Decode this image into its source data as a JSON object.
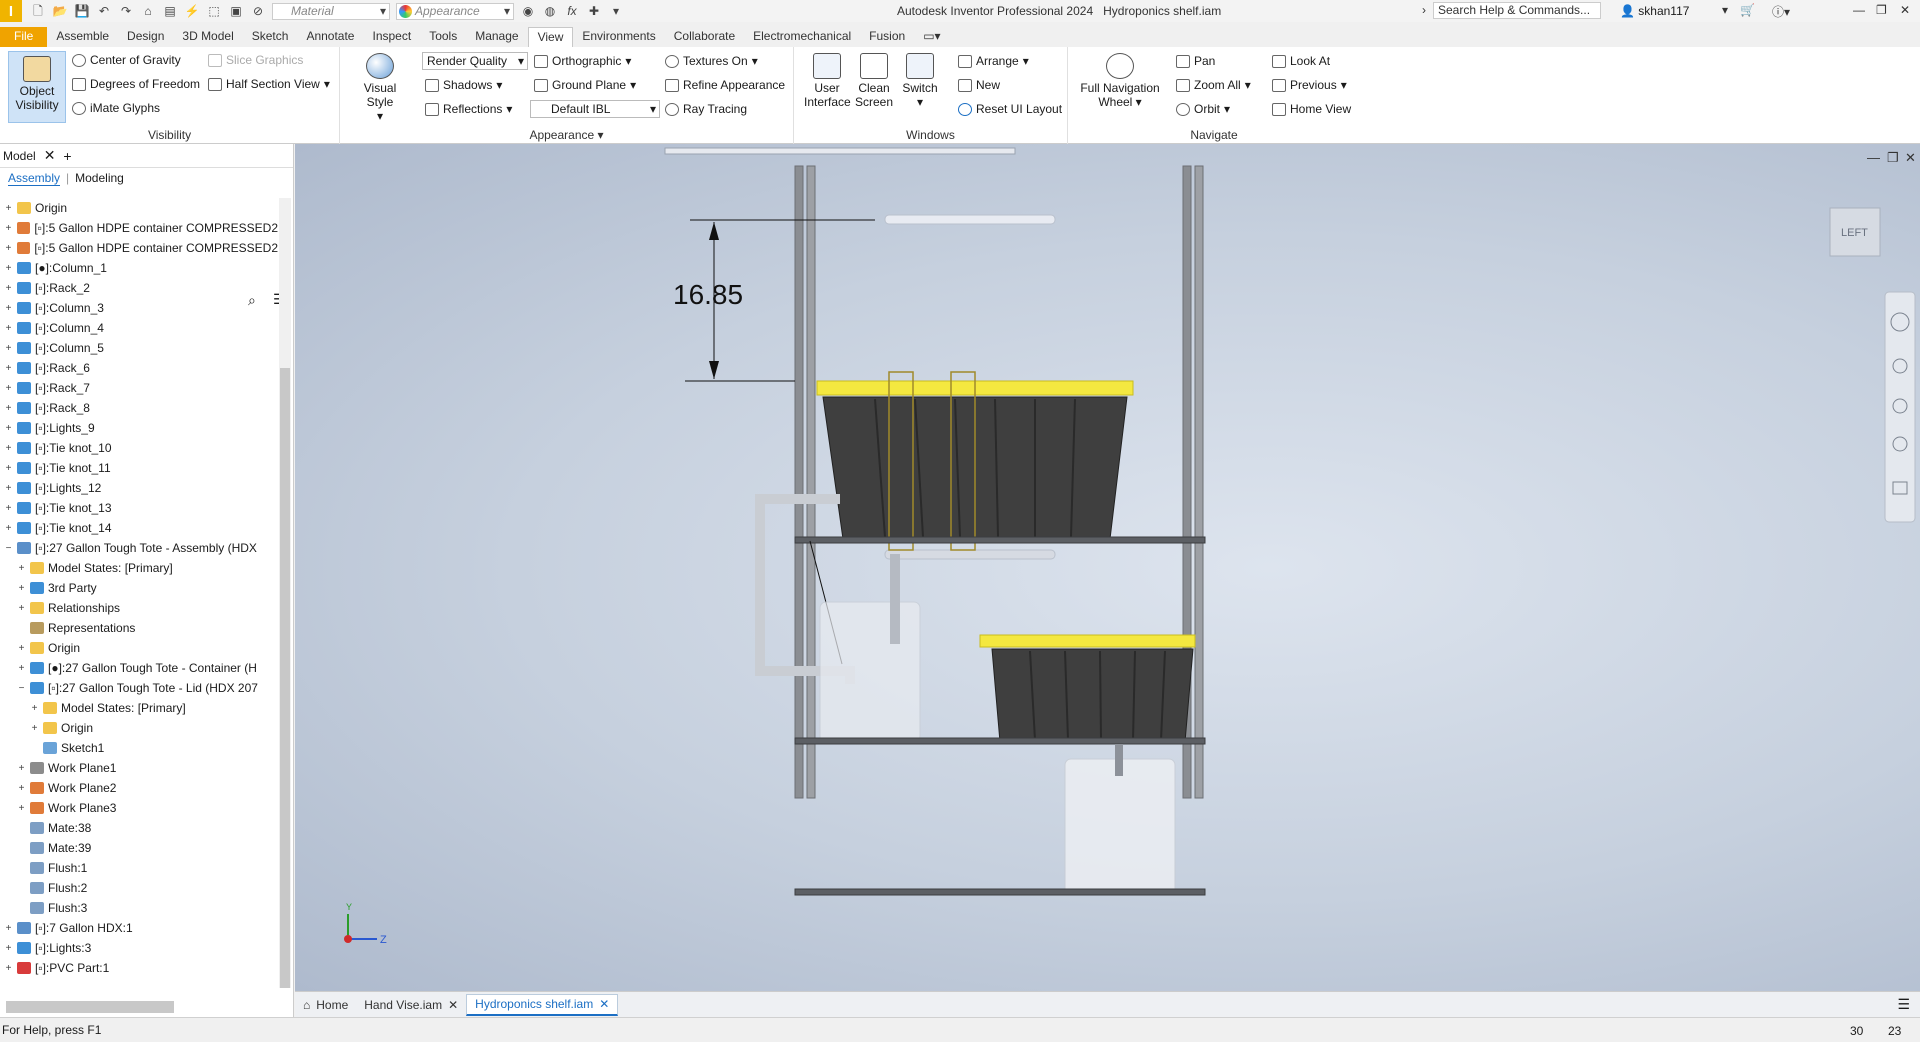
{
  "app": {
    "title": "Autodesk Inventor Professional 2024",
    "document": "Hydroponics shelf.iam",
    "search_placeholder": "Search Help & Commands...",
    "user": "skhan117",
    "logo": "I",
    "material_placeholder": "Material",
    "appearance_placeholder": "Appearance",
    "accent": "#f0a300"
  },
  "tabs": [
    "File",
    "Assemble",
    "Design",
    "3D Model",
    "Sketch",
    "Annotate",
    "Inspect",
    "Tools",
    "Manage",
    "View",
    "Environments",
    "Collaborate",
    "Electromechanical",
    "Fusion"
  ],
  "active_tab": "View",
  "ribbon": {
    "visibility": {
      "label": "Visibility",
      "object_visibility": "Object Visibility",
      "center_of_gravity": "Center of Gravity",
      "slice_graphics": "Slice Graphics",
      "degrees_of_freedom": "Degrees of Freedom",
      "half_section_view": "Half Section View",
      "imate_glyphs": "iMate Glyphs"
    },
    "appearance": {
      "label": "Appearance",
      "visual_style": "Visual Style",
      "render_quality": "Render Quality",
      "orthographic": "Orthographic",
      "textures_on": "Textures On",
      "shadows": "Shadows",
      "ground_plane": "Ground Plane",
      "refine_appearance": "Refine Appearance",
      "reflections": "Reflections",
      "default_ibl": "Default IBL",
      "ray_tracing": "Ray Tracing"
    },
    "windows": {
      "label": "Windows",
      "user_interface": "User Interface",
      "clean_screen": "Clean Screen",
      "switch": "Switch",
      "arrange": "Arrange",
      "new": "New",
      "reset_ui_layout": "Reset UI Layout"
    },
    "navigate": {
      "label": "Navigate",
      "full_navigation_wheel": "Full Navigation Wheel",
      "pan": "Pan",
      "zoom_all": "Zoom All",
      "orbit": "Orbit",
      "look_at": "Look At",
      "previous": "Previous",
      "home_view": "Home View"
    }
  },
  "browser": {
    "title": "Model",
    "sub_tabs": [
      "Assembly",
      "Modeling"
    ],
    "tree": [
      {
        "depth": 0,
        "exp": "+",
        "icon": "folder-icon",
        "color": "#f2c54b",
        "label": "Origin"
      },
      {
        "depth": 0,
        "exp": "+",
        "icon": "part-icon",
        "color": "#e07b39",
        "label": "[▫]:5 Gallon HDPE container COMPRESSED2"
      },
      {
        "depth": 0,
        "exp": "+",
        "icon": "part-icon",
        "color": "#e07b39",
        "label": "[▫]:5 Gallon HDPE container COMPRESSED2"
      },
      {
        "depth": 0,
        "exp": "+",
        "icon": "part-icon",
        "color": "#3d8fd6",
        "label": "[●]:Column_1"
      },
      {
        "depth": 0,
        "exp": "+",
        "icon": "part-icon",
        "color": "#3d8fd6",
        "label": "[▫]:Rack_2"
      },
      {
        "depth": 0,
        "exp": "+",
        "icon": "part-icon",
        "color": "#3d8fd6",
        "label": "[▫]:Column_3"
      },
      {
        "depth": 0,
        "exp": "+",
        "icon": "part-icon",
        "color": "#3d8fd6",
        "label": "[▫]:Column_4"
      },
      {
        "depth": 0,
        "exp": "+",
        "icon": "part-icon",
        "color": "#3d8fd6",
        "label": "[▫]:Column_5"
      },
      {
        "depth": 0,
        "exp": "+",
        "icon": "part-icon",
        "color": "#3d8fd6",
        "label": "[▫]:Rack_6"
      },
      {
        "depth": 0,
        "exp": "+",
        "icon": "part-icon",
        "color": "#3d8fd6",
        "label": "[▫]:Rack_7"
      },
      {
        "depth": 0,
        "exp": "+",
        "icon": "part-icon",
        "color": "#3d8fd6",
        "label": "[▫]:Rack_8"
      },
      {
        "depth": 0,
        "exp": "+",
        "icon": "part-icon",
        "color": "#3d8fd6",
        "label": "[▫]:Lights_9"
      },
      {
        "depth": 0,
        "exp": "+",
        "icon": "part-icon",
        "color": "#3d8fd6",
        "label": "[▫]:Tie knot_10"
      },
      {
        "depth": 0,
        "exp": "+",
        "icon": "part-icon",
        "color": "#3d8fd6",
        "label": "[▫]:Tie knot_11"
      },
      {
        "depth": 0,
        "exp": "+",
        "icon": "part-icon",
        "color": "#3d8fd6",
        "label": "[▫]:Lights_12"
      },
      {
        "depth": 0,
        "exp": "+",
        "icon": "part-icon",
        "color": "#3d8fd6",
        "label": "[▫]:Tie knot_13"
      },
      {
        "depth": 0,
        "exp": "+",
        "icon": "part-icon",
        "color": "#3d8fd6",
        "label": "[▫]:Tie knot_14"
      },
      {
        "depth": 0,
        "exp": "−",
        "icon": "assembly-icon",
        "color": "#5a8fc9",
        "label": "[▫]:27 Gallon Tough Tote - Assembly (HDX"
      },
      {
        "depth": 1,
        "exp": "+",
        "icon": "folder-icon",
        "color": "#f2c54b",
        "label": "Model States: [Primary]"
      },
      {
        "depth": 1,
        "exp": "+",
        "icon": "part-icon",
        "color": "#3d8fd6",
        "label": "3rd Party"
      },
      {
        "depth": 1,
        "exp": "+",
        "icon": "folder-icon",
        "color": "#f2c54b",
        "label": "Relationships"
      },
      {
        "depth": 1,
        "exp": "",
        "icon": "representations-icon",
        "color": "#b89b5e",
        "label": "Representations"
      },
      {
        "depth": 1,
        "exp": "+",
        "icon": "folder-icon",
        "color": "#f2c54b",
        "label": "Origin"
      },
      {
        "depth": 1,
        "exp": "+",
        "icon": "part-icon",
        "color": "#3d8fd6",
        "label": "[●]:27 Gallon Tough Tote - Container (H"
      },
      {
        "depth": 1,
        "exp": "−",
        "icon": "part-icon",
        "color": "#3d8fd6",
        "label": "[▫]:27 Gallon Tough Tote - Lid (HDX 207"
      },
      {
        "depth": 2,
        "exp": "+",
        "icon": "folder-icon",
        "color": "#f2c54b",
        "label": "Model States: [Primary]"
      },
      {
        "depth": 2,
        "exp": "+",
        "icon": "folder-icon",
        "color": "#f2c54b",
        "label": "Origin"
      },
      {
        "depth": 2,
        "exp": "",
        "icon": "sketch-icon",
        "color": "#6aa3d8",
        "label": "Sketch1"
      },
      {
        "depth": 1,
        "exp": "+",
        "icon": "work-plane-icon",
        "color": "#8c8c8c",
        "label": "Work Plane1"
      },
      {
        "depth": 1,
        "exp": "+",
        "icon": "work-plane-icon",
        "color": "#e07b39",
        "label": "Work Plane2"
      },
      {
        "depth": 1,
        "exp": "+",
        "icon": "work-plane-icon",
        "color": "#e07b39",
        "label": "Work Plane3"
      },
      {
        "depth": 1,
        "exp": "",
        "icon": "mate-icon",
        "color": "#7d9ec4",
        "label": "Mate:38"
      },
      {
        "depth": 1,
        "exp": "",
        "icon": "mate-icon",
        "color": "#7d9ec4",
        "label": "Mate:39"
      },
      {
        "depth": 1,
        "exp": "",
        "icon": "flush-icon",
        "color": "#7d9ec4",
        "label": "Flush:1"
      },
      {
        "depth": 1,
        "exp": "",
        "icon": "flush-icon",
        "color": "#7d9ec4",
        "label": "Flush:2"
      },
      {
        "depth": 1,
        "exp": "",
        "icon": "flush-icon",
        "color": "#7d9ec4",
        "label": "Flush:3"
      },
      {
        "depth": 0,
        "exp": "+",
        "icon": "assembly-icon",
        "color": "#5a8fc9",
        "label": "[▫]:7 Gallon HDX:1"
      },
      {
        "depth": 0,
        "exp": "+",
        "icon": "part-icon",
        "color": "#3d8fd6",
        "label": "[▫]:Lights:3"
      },
      {
        "depth": 0,
        "exp": "+",
        "icon": "update-icon",
        "color": "#d83b3b",
        "label": "[▫]:PVC Part:1"
      }
    ]
  },
  "viewport": {
    "dimension": "16.85",
    "viewcube_face": "LEFT",
    "axis_y": "Y",
    "axis_z": "Z"
  },
  "doc_tabs": [
    "Home",
    "Hand Vise.iam",
    "Hydroponics shelf.iam"
  ],
  "active_doc": "Hydroponics shelf.iam",
  "status": {
    "help": "For Help, press F1",
    "n1": "30",
    "n2": "23"
  }
}
